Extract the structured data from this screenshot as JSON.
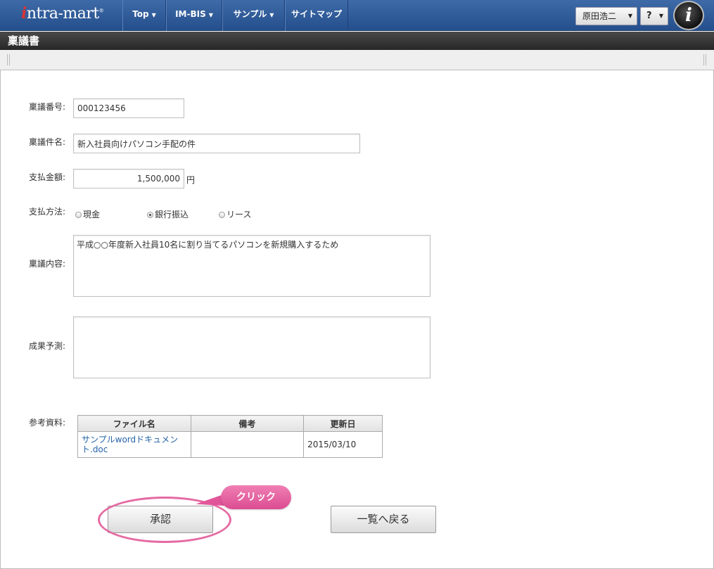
{
  "header": {
    "logo_text": "ntra-mart",
    "logo_i": "i",
    "logo_reg": "®",
    "nav": [
      {
        "label": "Top",
        "icon": "caret-down"
      },
      {
        "label": "IM-BIS",
        "icon": "caret-down"
      },
      {
        "label": "サンプル",
        "icon": "caret-down"
      },
      {
        "label": "サイトマップ"
      }
    ],
    "user_name": "原田浩二",
    "help_label": "?",
    "caret": "▼",
    "im_logo_letter": "i"
  },
  "page": {
    "title": "稟議書"
  },
  "form": {
    "proposal_number": {
      "label": "稟議番号:",
      "value": "000123456"
    },
    "subject": {
      "label": "稟議件名:",
      "value": "新入社員向けパソコン手配の件"
    },
    "amount": {
      "label": "支払金額:",
      "value": "1,500,000",
      "unit": "円"
    },
    "payment_method": {
      "label": "支払方法:",
      "options": [
        {
          "label": "現金",
          "checked": false
        },
        {
          "label": "銀行振込",
          "checked": true
        },
        {
          "label": "リース",
          "checked": false
        }
      ]
    },
    "content": {
      "label": "稟議内容:",
      "value": "平成○○年度新入社員10名に割り当てるパソコンを新規購入するため"
    },
    "expected_result": {
      "label": "成果予測:",
      "value": ""
    },
    "reference": {
      "label": "参考資料:",
      "columns": [
        "ファイル名",
        "備考",
        "更新日"
      ],
      "rows": [
        {
          "file_name": "サンプルwordドキュメント.doc",
          "note": "",
          "updated": "2015/03/10"
        }
      ]
    }
  },
  "actions": {
    "approve_label": "承認",
    "back_label": "一覧へ戻る",
    "callout_label": "クリック",
    "callout_color": "#e56aa3"
  }
}
